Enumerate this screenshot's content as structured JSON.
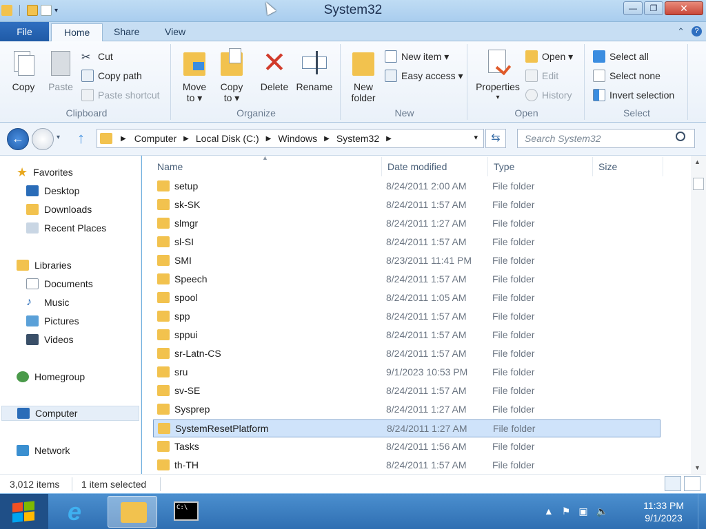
{
  "window": {
    "title": "System32",
    "buttons": {
      "minimize": "—",
      "maximize": "❐",
      "close": "✕"
    }
  },
  "ribbon_tabs": [
    {
      "label": "File"
    },
    {
      "label": "Home"
    },
    {
      "label": "Share"
    },
    {
      "label": "View"
    }
  ],
  "ribbon": {
    "clipboard": {
      "label": "Clipboard",
      "copy": "Copy",
      "paste": "Paste",
      "cut": "Cut",
      "copy_path": "Copy path",
      "paste_shortcut": "Paste shortcut"
    },
    "organize": {
      "label": "Organize",
      "move_to": "Move",
      "move_to_2": "to ▾",
      "copy_to": "Copy",
      "copy_to_2": "to ▾",
      "delete": "Delete",
      "rename": "Rename"
    },
    "new": {
      "label": "New",
      "new_folder": "New",
      "new_folder_2": "folder",
      "new_item": "New item ▾",
      "easy_access": "Easy access ▾"
    },
    "open": {
      "label": "Open",
      "properties": "Properties",
      "open": "Open ▾",
      "edit": "Edit",
      "history": "History"
    },
    "select": {
      "label": "Select",
      "select_all": "Select all",
      "select_none": "Select none",
      "invert_selection": "Invert selection"
    }
  },
  "address": {
    "crumbs": [
      "Computer",
      "Local Disk (C:)",
      "Windows",
      "System32"
    ],
    "search_placeholder": "Search System32"
  },
  "nav": {
    "favorites": "Favorites",
    "desktop": "Desktop",
    "downloads": "Downloads",
    "recent": "Recent Places",
    "libraries": "Libraries",
    "documents": "Documents",
    "music": "Music",
    "pictures": "Pictures",
    "videos": "Videos",
    "homegroup": "Homegroup",
    "computer": "Computer",
    "network": "Network"
  },
  "columns": {
    "name": "Name",
    "date": "Date modified",
    "type": "Type",
    "size": "Size"
  },
  "files": [
    {
      "name": "setup",
      "date": "8/24/2011 2:00 AM",
      "type": "File folder"
    },
    {
      "name": "sk-SK",
      "date": "8/24/2011 1:57 AM",
      "type": "File folder"
    },
    {
      "name": "slmgr",
      "date": "8/24/2011 1:27 AM",
      "type": "File folder"
    },
    {
      "name": "sl-SI",
      "date": "8/24/2011 1:57 AM",
      "type": "File folder"
    },
    {
      "name": "SMI",
      "date": "8/23/2011 11:41 PM",
      "type": "File folder"
    },
    {
      "name": "Speech",
      "date": "8/24/2011 1:57 AM",
      "type": "File folder"
    },
    {
      "name": "spool",
      "date": "8/24/2011 1:05 AM",
      "type": "File folder"
    },
    {
      "name": "spp",
      "date": "8/24/2011 1:57 AM",
      "type": "File folder"
    },
    {
      "name": "sppui",
      "date": "8/24/2011 1:57 AM",
      "type": "File folder"
    },
    {
      "name": "sr-Latn-CS",
      "date": "8/24/2011 1:57 AM",
      "type": "File folder"
    },
    {
      "name": "sru",
      "date": "9/1/2023 10:53 PM",
      "type": "File folder"
    },
    {
      "name": "sv-SE",
      "date": "8/24/2011 1:57 AM",
      "type": "File folder"
    },
    {
      "name": "Sysprep",
      "date": "8/24/2011 1:27 AM",
      "type": "File folder"
    },
    {
      "name": "SystemResetPlatform",
      "date": "8/24/2011 1:27 AM",
      "type": "File folder",
      "selected": true
    },
    {
      "name": "Tasks",
      "date": "8/24/2011 1:56 AM",
      "type": "File folder"
    },
    {
      "name": "th-TH",
      "date": "8/24/2011 1:57 AM",
      "type": "File folder"
    }
  ],
  "status": {
    "items": "3,012 items",
    "selected": "1 item selected"
  },
  "taskbar": {
    "time": "11:33 PM",
    "date": "9/1/2023"
  },
  "colors": {
    "folder": "#f2c24e",
    "selection": "#cfe3fa",
    "taskbar": "#3a7cc0"
  }
}
